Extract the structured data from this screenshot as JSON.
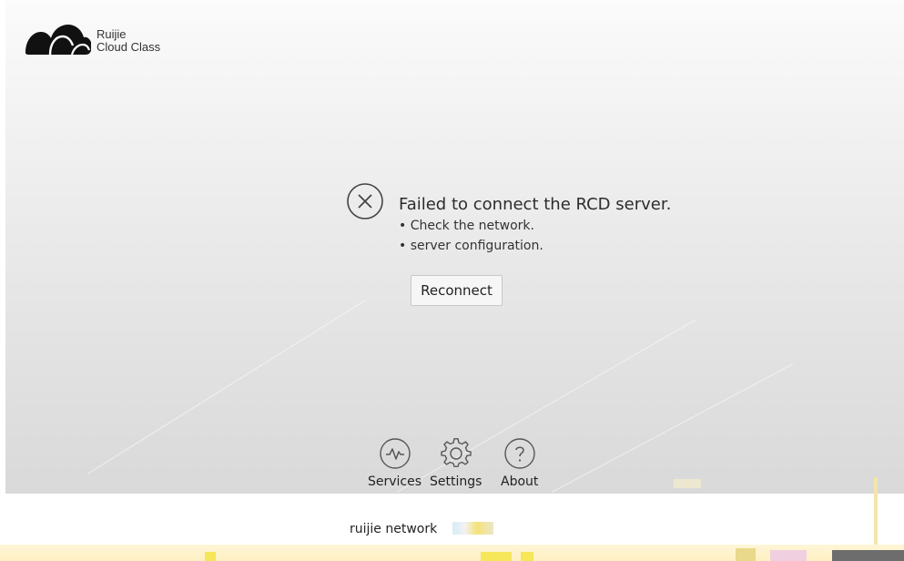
{
  "brand": {
    "name_line1": "Ruijie",
    "name_line2": "Cloud Class"
  },
  "error": {
    "icon": "close-circle-icon",
    "title": "Failed to connect the RCD server.",
    "hints": [
      "• Check the network.",
      "• server configuration."
    ]
  },
  "actions": {
    "reconnect_label": "Reconnect"
  },
  "toolbar": {
    "items": [
      {
        "icon": "pulse-icon",
        "label": "Services"
      },
      {
        "icon": "gear-icon",
        "label": "Settings"
      },
      {
        "icon": "question-icon",
        "label": "About"
      }
    ]
  },
  "footer": {
    "text": "ruijie network"
  },
  "colors": {
    "panel_top": "#fbfbfb",
    "panel_bottom": "#d9d9d9",
    "text": "#2c2c2c",
    "button_bg": "#f6f6f6",
    "button_border": "#c8c8c8",
    "bottom_band": "#fff0c2"
  }
}
